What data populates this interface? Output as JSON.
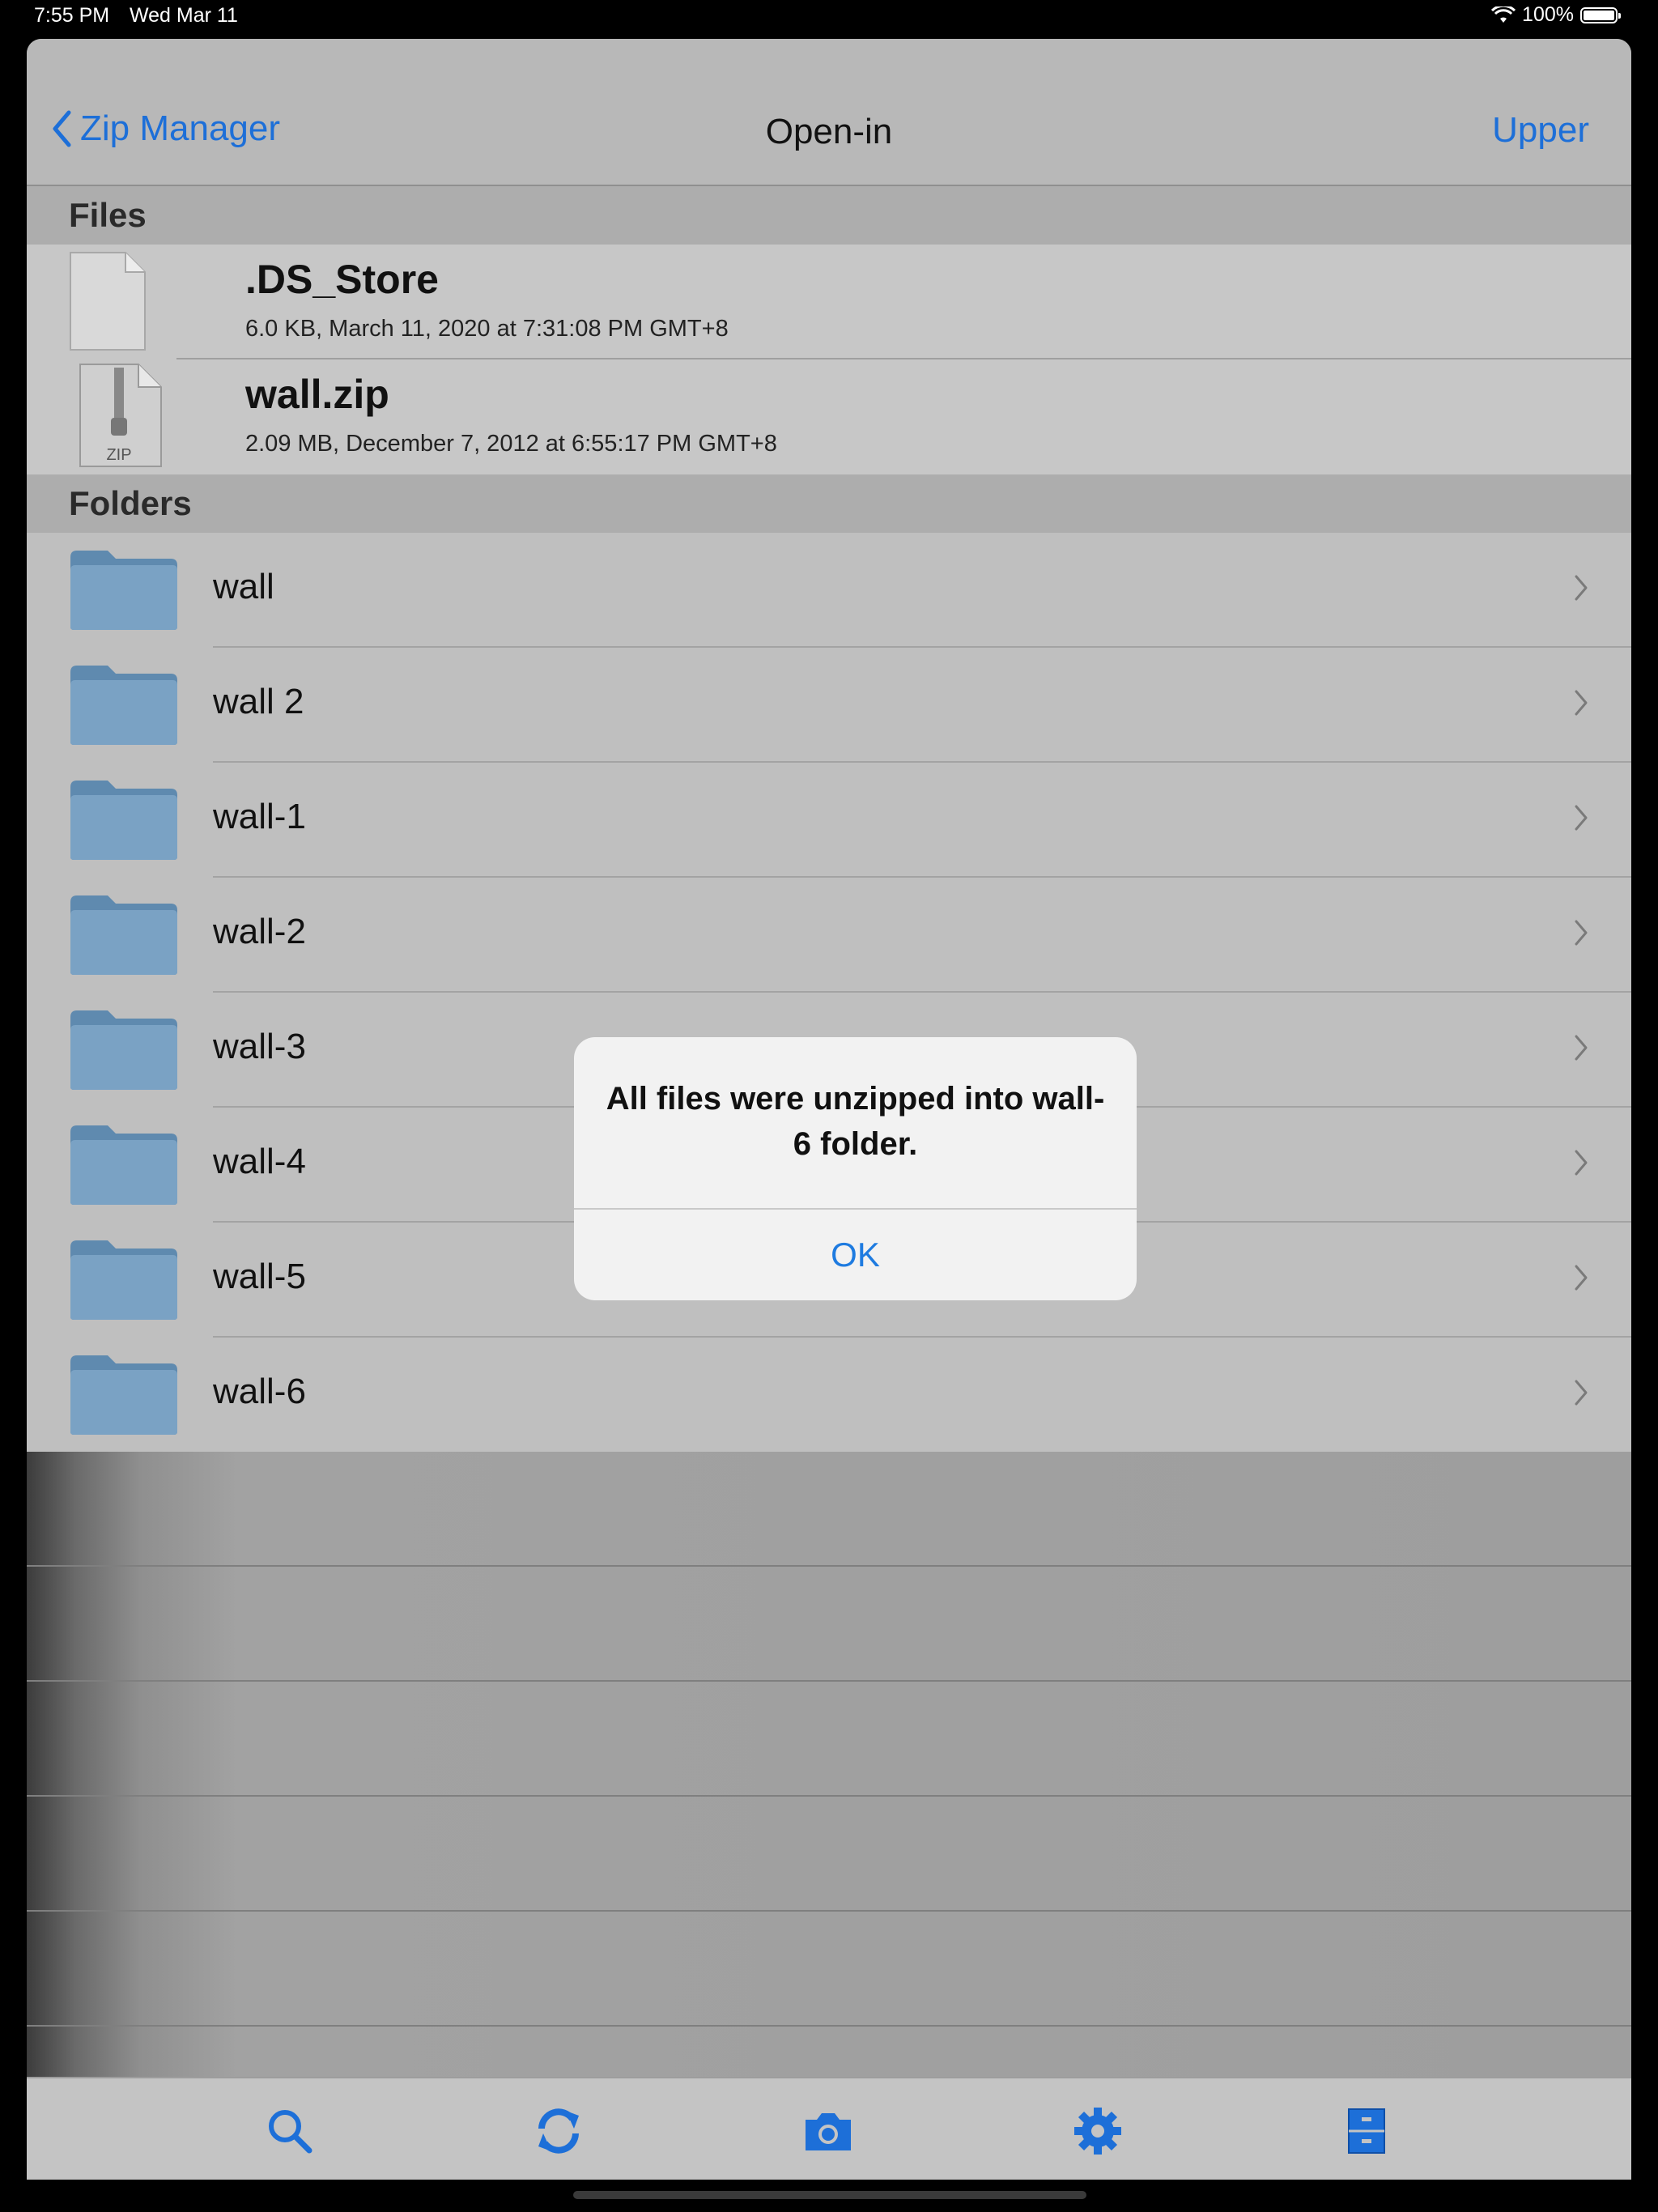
{
  "status_bar": {
    "time": "7:55 PM",
    "date": "Wed Mar 11",
    "battery": "100%"
  },
  "nav": {
    "back_label": "Zip Manager",
    "title": "Open-in",
    "right_label": "Upper"
  },
  "sections": {
    "files": "Files",
    "folders": "Folders"
  },
  "files": [
    {
      "name": ".DS_Store",
      "meta": "6.0 KB, March 11, 2020 at 7:31:08 PM GMT+8",
      "icon": "blank-document-icon"
    },
    {
      "name": "wall.zip",
      "meta": "2.09 MB, December 7, 2012 at 6:55:17 PM GMT+8",
      "icon": "zip-file-icon",
      "icon_text": "ZIP"
    }
  ],
  "folders": [
    "wall",
    "wall 2",
    "wall-1",
    "wall-2",
    "wall-3",
    "wall-4",
    "wall-5",
    "wall-6"
  ],
  "dialog": {
    "message": "All files were unzipped into wall-6 folder.",
    "button": "OK"
  },
  "toolbar": [
    "search-icon",
    "refresh-icon",
    "camera-icon",
    "gear-icon",
    "file-cabinet-icon"
  ],
  "colors": {
    "accent": "#1d6fd8",
    "folder": "#6b95b8"
  }
}
